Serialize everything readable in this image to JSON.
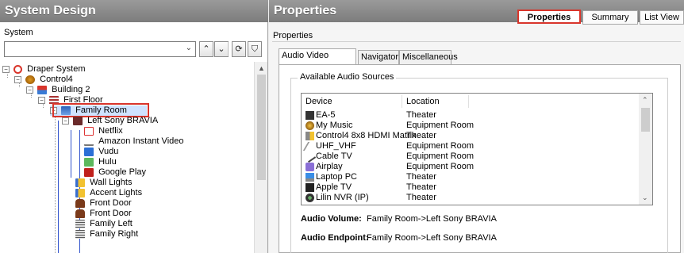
{
  "left_panel": {
    "title": "System Design",
    "sublabel": "System",
    "toolbar": {
      "combo_value": "",
      "up_label": "^",
      "down_label": "v",
      "refresh_label": "⟳",
      "filter_label": "⛉"
    },
    "tree": [
      {
        "label": "Draper System",
        "icon": "draper-logo-icon",
        "expander": "−"
      },
      {
        "label": "Control4",
        "icon": "control4-icon",
        "expander": "−"
      },
      {
        "label": "Building 2",
        "icon": "building-icon",
        "expander": "−"
      },
      {
        "label": "First Floor",
        "icon": "floor-icon",
        "expander": "−"
      },
      {
        "label": "Family Room",
        "icon": "room-icon",
        "expander": "−"
      },
      {
        "label": "Left Sony BRAVIA",
        "icon": "tv-icon",
        "expander": "−"
      },
      {
        "label": "Netflix",
        "icon": "netflix-icon"
      },
      {
        "label": "Amazon Instant Video",
        "icon": "amazon-icon"
      },
      {
        "label": "Vudu",
        "icon": "vudu-icon"
      },
      {
        "label": "Hulu",
        "icon": "hulu-icon"
      },
      {
        "label": "Google Play",
        "icon": "google-play-icon"
      },
      {
        "label": "Wall Lights",
        "icon": "light-icon"
      },
      {
        "label": "Accent Lights",
        "icon": "light-icon"
      },
      {
        "label": "Front Door",
        "icon": "door-lock-icon"
      },
      {
        "label": "Front Door",
        "icon": "door-lock-icon"
      },
      {
        "label": "Family Left",
        "icon": "blinds-icon"
      },
      {
        "label": "Family Right",
        "icon": "blinds-icon"
      }
    ]
  },
  "right_panel": {
    "title": "Properties",
    "top_tabs": [
      "Properties",
      "Summary",
      "List View"
    ],
    "sublabel": "Properties",
    "inner_tabs": [
      "Audio Video Devices",
      "Navigator",
      "Miscellaneous"
    ],
    "group_title": "Available Audio Sources",
    "list_headers": [
      "Device",
      "Location"
    ],
    "list_rows": [
      {
        "device": "EA-5",
        "location": "Theater",
        "icon": "ea5-icon"
      },
      {
        "device": "My Music",
        "location": "Equipment Room",
        "icon": "music-icon"
      },
      {
        "device": "Control4 8x8 HDMI Matrix",
        "location": "Theater",
        "icon": "matrix-icon"
      },
      {
        "device": "UHF_VHF",
        "location": "Equipment Room",
        "icon": "antenna-icon"
      },
      {
        "device": "Cable TV",
        "location": "Equipment Room",
        "icon": "cable-icon"
      },
      {
        "device": "Airplay",
        "location": "Equipment Room",
        "icon": "airplay-icon"
      },
      {
        "device": "Laptop PC",
        "location": "Theater",
        "icon": "laptop-icon"
      },
      {
        "device": "Apple TV",
        "location": "Theater",
        "icon": "apple-tv-icon"
      },
      {
        "device": "Lilin NVR (IP)",
        "location": "Theater",
        "icon": "nvr-icon"
      }
    ],
    "audio_volume_label": "Audio Volume:",
    "audio_volume_value": "Family Room->Left Sony BRAVIA",
    "audio_endpoint_label": "Audio Endpoint:",
    "audio_endpoint_value": "Family Room->Left Sony BRAVIA"
  },
  "colors": {
    "header_gray": "#8a8a8a",
    "highlight_red": "#d9352b",
    "selection_blue": "#cfe3ff",
    "tree_blue_line": "#3355cc"
  }
}
